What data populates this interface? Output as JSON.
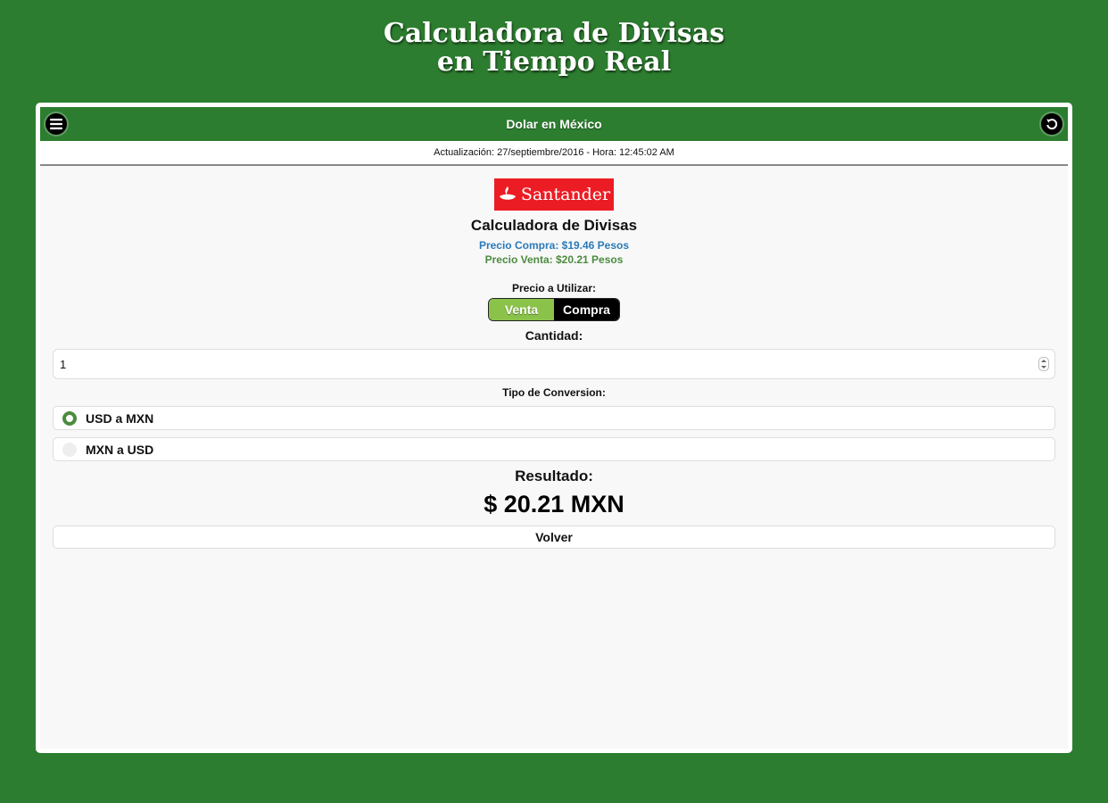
{
  "promo": {
    "title_line1": "Calculadora de Divisas",
    "title_line2": "en Tiempo Real"
  },
  "header": {
    "title": "Dolar en México",
    "left_icon": "menu-icon",
    "right_icon": "refresh-icon"
  },
  "update_info": "Actualización: 27/septiembre/2016 - Hora: 12:45:02 AM",
  "bank": {
    "logo_text": "Santander",
    "logo_color": "#ec1c24"
  },
  "calculator": {
    "title": "Calculadora de Divisas",
    "buy_price": "Precio Compra: $19.46 Pesos",
    "sell_price": "Precio Venta: $20.21 Pesos",
    "price_to_use_label": "Precio a Utilizar:",
    "price_options": [
      "Venta",
      "Compra"
    ],
    "selected_price": "Venta",
    "quantity_label": "Cantidad:",
    "quantity_value": "1",
    "conversion_label": "Tipo de Conversion:",
    "conversion_options": [
      "USD a MXN",
      "MXN a USD"
    ],
    "selected_conversion": "USD a MXN",
    "result_label": "Resultado:",
    "result_value": "$ 20.21 MXN",
    "back_label": "Volver"
  },
  "colors": {
    "brand_green": "#2c7d2f",
    "toggle_active": "#8bc34a",
    "buy_price_color": "#2a7ab8",
    "sell_price_color": "#4c8b3e"
  }
}
